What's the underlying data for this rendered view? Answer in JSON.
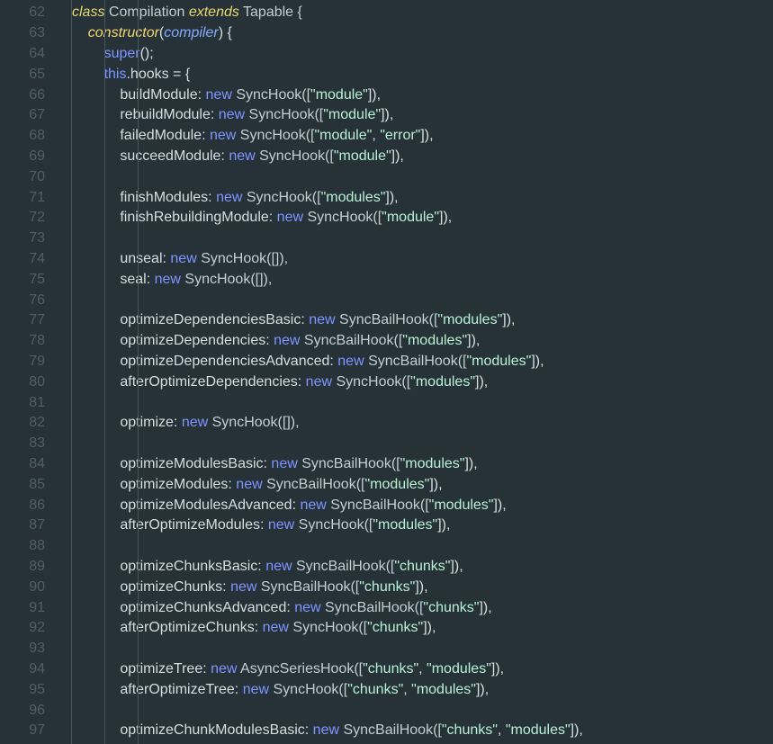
{
  "editor": {
    "lines": [
      {
        "number": "62",
        "parts": [
          {
            "text": "class",
            "kind": "class-kw"
          },
          {
            "text": " Compilation ",
            "kind": "type"
          },
          {
            "text": "extends",
            "kind": "extends-kw"
          },
          {
            "text": " Tapable {",
            "kind": "type"
          }
        ]
      },
      {
        "number": "63",
        "parts": [
          {
            "text": "    ",
            "kind": "punc"
          },
          {
            "text": "constructor",
            "kind": "fn"
          },
          {
            "text": "(",
            "kind": "punc"
          },
          {
            "text": "compiler",
            "kind": "param"
          },
          {
            "text": ") {",
            "kind": "punc"
          }
        ]
      },
      {
        "number": "64",
        "parts": [
          {
            "text": "        ",
            "kind": "punc"
          },
          {
            "text": "super",
            "kind": "kw"
          },
          {
            "text": "();",
            "kind": "punc"
          }
        ]
      },
      {
        "number": "65",
        "parts": [
          {
            "text": "        ",
            "kind": "punc"
          },
          {
            "text": "this",
            "kind": "kw"
          },
          {
            "text": ".hooks = {",
            "kind": "punc"
          }
        ]
      },
      {
        "number": "66",
        "parts": [
          {
            "text": "            ",
            "kind": "punc"
          },
          {
            "text": "buildModule",
            "kind": "property"
          },
          {
            "text": ": ",
            "kind": "punc"
          },
          {
            "text": "new",
            "kind": "kw"
          },
          {
            "text": " SyncHook([",
            "kind": "type"
          },
          {
            "text": "\"module\"",
            "kind": "string"
          },
          {
            "text": "]),",
            "kind": "punc"
          }
        ]
      },
      {
        "number": "67",
        "parts": [
          {
            "text": "            ",
            "kind": "punc"
          },
          {
            "text": "rebuildModule",
            "kind": "property"
          },
          {
            "text": ": ",
            "kind": "punc"
          },
          {
            "text": "new",
            "kind": "kw"
          },
          {
            "text": " SyncHook([",
            "kind": "type"
          },
          {
            "text": "\"module\"",
            "kind": "string"
          },
          {
            "text": "]),",
            "kind": "punc"
          }
        ]
      },
      {
        "number": "68",
        "parts": [
          {
            "text": "            ",
            "kind": "punc"
          },
          {
            "text": "failedModule",
            "kind": "property"
          },
          {
            "text": ": ",
            "kind": "punc"
          },
          {
            "text": "new",
            "kind": "kw"
          },
          {
            "text": " SyncHook([",
            "kind": "type"
          },
          {
            "text": "\"module\"",
            "kind": "string"
          },
          {
            "text": ", ",
            "kind": "punc"
          },
          {
            "text": "\"error\"",
            "kind": "string"
          },
          {
            "text": "]),",
            "kind": "punc"
          }
        ]
      },
      {
        "number": "69",
        "parts": [
          {
            "text": "            ",
            "kind": "punc"
          },
          {
            "text": "succeedModule",
            "kind": "property"
          },
          {
            "text": ": ",
            "kind": "punc"
          },
          {
            "text": "new",
            "kind": "kw"
          },
          {
            "text": " SyncHook([",
            "kind": "type"
          },
          {
            "text": "\"module\"",
            "kind": "string"
          },
          {
            "text": "]),",
            "kind": "punc"
          }
        ]
      },
      {
        "number": "70",
        "parts": []
      },
      {
        "number": "71",
        "parts": [
          {
            "text": "            ",
            "kind": "punc"
          },
          {
            "text": "finishModules",
            "kind": "property"
          },
          {
            "text": ": ",
            "kind": "punc"
          },
          {
            "text": "new",
            "kind": "kw"
          },
          {
            "text": " SyncHook([",
            "kind": "type"
          },
          {
            "text": "\"modules\"",
            "kind": "string"
          },
          {
            "text": "]),",
            "kind": "punc"
          }
        ]
      },
      {
        "number": "72",
        "parts": [
          {
            "text": "            ",
            "kind": "punc"
          },
          {
            "text": "finishRebuildingModule",
            "kind": "property"
          },
          {
            "text": ": ",
            "kind": "punc"
          },
          {
            "text": "new",
            "kind": "kw"
          },
          {
            "text": " SyncHook([",
            "kind": "type"
          },
          {
            "text": "\"module\"",
            "kind": "string"
          },
          {
            "text": "]),",
            "kind": "punc"
          }
        ]
      },
      {
        "number": "73",
        "parts": []
      },
      {
        "number": "74",
        "parts": [
          {
            "text": "            ",
            "kind": "punc"
          },
          {
            "text": "unseal",
            "kind": "property"
          },
          {
            "text": ": ",
            "kind": "punc"
          },
          {
            "text": "new",
            "kind": "kw"
          },
          {
            "text": " SyncHook([]),",
            "kind": "type"
          }
        ]
      },
      {
        "number": "75",
        "parts": [
          {
            "text": "            ",
            "kind": "punc"
          },
          {
            "text": "seal",
            "kind": "property"
          },
          {
            "text": ": ",
            "kind": "punc"
          },
          {
            "text": "new",
            "kind": "kw"
          },
          {
            "text": " SyncHook([]),",
            "kind": "type"
          }
        ]
      },
      {
        "number": "76",
        "parts": []
      },
      {
        "number": "77",
        "parts": [
          {
            "text": "            ",
            "kind": "punc"
          },
          {
            "text": "optimizeDependenciesBasic",
            "kind": "property"
          },
          {
            "text": ": ",
            "kind": "punc"
          },
          {
            "text": "new",
            "kind": "kw"
          },
          {
            "text": " SyncBailHook([",
            "kind": "type"
          },
          {
            "text": "\"modules\"",
            "kind": "string"
          },
          {
            "text": "]),",
            "kind": "punc"
          }
        ]
      },
      {
        "number": "78",
        "parts": [
          {
            "text": "            ",
            "kind": "punc"
          },
          {
            "text": "optimizeDependencies",
            "kind": "property"
          },
          {
            "text": ": ",
            "kind": "punc"
          },
          {
            "text": "new",
            "kind": "kw"
          },
          {
            "text": " SyncBailHook([",
            "kind": "type"
          },
          {
            "text": "\"modules\"",
            "kind": "string"
          },
          {
            "text": "]),",
            "kind": "punc"
          }
        ]
      },
      {
        "number": "79",
        "parts": [
          {
            "text": "            ",
            "kind": "punc"
          },
          {
            "text": "optimizeDependenciesAdvanced",
            "kind": "property"
          },
          {
            "text": ": ",
            "kind": "punc"
          },
          {
            "text": "new",
            "kind": "kw"
          },
          {
            "text": " SyncBailHook([",
            "kind": "type"
          },
          {
            "text": "\"modules\"",
            "kind": "string"
          },
          {
            "text": "]),",
            "kind": "punc"
          }
        ]
      },
      {
        "number": "80",
        "parts": [
          {
            "text": "            ",
            "kind": "punc"
          },
          {
            "text": "afterOptimizeDependencies",
            "kind": "property"
          },
          {
            "text": ": ",
            "kind": "punc"
          },
          {
            "text": "new",
            "kind": "kw"
          },
          {
            "text": " SyncHook([",
            "kind": "type"
          },
          {
            "text": "\"modules\"",
            "kind": "string"
          },
          {
            "text": "]),",
            "kind": "punc"
          }
        ]
      },
      {
        "number": "81",
        "parts": []
      },
      {
        "number": "82",
        "parts": [
          {
            "text": "            ",
            "kind": "punc"
          },
          {
            "text": "optimize",
            "kind": "property"
          },
          {
            "text": ": ",
            "kind": "punc"
          },
          {
            "text": "new",
            "kind": "kw"
          },
          {
            "text": " SyncHook([]),",
            "kind": "type"
          }
        ]
      },
      {
        "number": "83",
        "parts": []
      },
      {
        "number": "84",
        "parts": [
          {
            "text": "            ",
            "kind": "punc"
          },
          {
            "text": "optimizeModulesBasic",
            "kind": "property"
          },
          {
            "text": ": ",
            "kind": "punc"
          },
          {
            "text": "new",
            "kind": "kw"
          },
          {
            "text": " SyncBailHook([",
            "kind": "type"
          },
          {
            "text": "\"modules\"",
            "kind": "string"
          },
          {
            "text": "]),",
            "kind": "punc"
          }
        ]
      },
      {
        "number": "85",
        "parts": [
          {
            "text": "            ",
            "kind": "punc"
          },
          {
            "text": "optimizeModules",
            "kind": "property"
          },
          {
            "text": ": ",
            "kind": "punc"
          },
          {
            "text": "new",
            "kind": "kw"
          },
          {
            "text": " SyncBailHook([",
            "kind": "type"
          },
          {
            "text": "\"modules\"",
            "kind": "string"
          },
          {
            "text": "]),",
            "kind": "punc"
          }
        ]
      },
      {
        "number": "86",
        "parts": [
          {
            "text": "            ",
            "kind": "punc"
          },
          {
            "text": "optimizeModulesAdvanced",
            "kind": "property"
          },
          {
            "text": ": ",
            "kind": "punc"
          },
          {
            "text": "new",
            "kind": "kw"
          },
          {
            "text": " SyncBailHook([",
            "kind": "type"
          },
          {
            "text": "\"modules\"",
            "kind": "string"
          },
          {
            "text": "]),",
            "kind": "punc"
          }
        ]
      },
      {
        "number": "87",
        "parts": [
          {
            "text": "            ",
            "kind": "punc"
          },
          {
            "text": "afterOptimizeModules",
            "kind": "property"
          },
          {
            "text": ": ",
            "kind": "punc"
          },
          {
            "text": "new",
            "kind": "kw"
          },
          {
            "text": " SyncHook([",
            "kind": "type"
          },
          {
            "text": "\"modules\"",
            "kind": "string"
          },
          {
            "text": "]),",
            "kind": "punc"
          }
        ]
      },
      {
        "number": "88",
        "parts": []
      },
      {
        "number": "89",
        "parts": [
          {
            "text": "            ",
            "kind": "punc"
          },
          {
            "text": "optimizeChunksBasic",
            "kind": "property"
          },
          {
            "text": ": ",
            "kind": "punc"
          },
          {
            "text": "new",
            "kind": "kw"
          },
          {
            "text": " SyncBailHook([",
            "kind": "type"
          },
          {
            "text": "\"chunks\"",
            "kind": "string"
          },
          {
            "text": "]),",
            "kind": "punc"
          }
        ]
      },
      {
        "number": "90",
        "parts": [
          {
            "text": "            ",
            "kind": "punc"
          },
          {
            "text": "optimizeChunks",
            "kind": "property"
          },
          {
            "text": ": ",
            "kind": "punc"
          },
          {
            "text": "new",
            "kind": "kw"
          },
          {
            "text": " SyncBailHook([",
            "kind": "type"
          },
          {
            "text": "\"chunks\"",
            "kind": "string"
          },
          {
            "text": "]),",
            "kind": "punc"
          }
        ]
      },
      {
        "number": "91",
        "parts": [
          {
            "text": "            ",
            "kind": "punc"
          },
          {
            "text": "optimizeChunksAdvanced",
            "kind": "property"
          },
          {
            "text": ": ",
            "kind": "punc"
          },
          {
            "text": "new",
            "kind": "kw"
          },
          {
            "text": " SyncBailHook([",
            "kind": "type"
          },
          {
            "text": "\"chunks\"",
            "kind": "string"
          },
          {
            "text": "]),",
            "kind": "punc"
          }
        ]
      },
      {
        "number": "92",
        "parts": [
          {
            "text": "            ",
            "kind": "punc"
          },
          {
            "text": "afterOptimizeChunks",
            "kind": "property"
          },
          {
            "text": ": ",
            "kind": "punc"
          },
          {
            "text": "new",
            "kind": "kw"
          },
          {
            "text": " SyncHook([",
            "kind": "type"
          },
          {
            "text": "\"chunks\"",
            "kind": "string"
          },
          {
            "text": "]),",
            "kind": "punc"
          }
        ]
      },
      {
        "number": "93",
        "parts": []
      },
      {
        "number": "94",
        "parts": [
          {
            "text": "            ",
            "kind": "punc"
          },
          {
            "text": "optimizeTree",
            "kind": "property"
          },
          {
            "text": ": ",
            "kind": "punc"
          },
          {
            "text": "new",
            "kind": "kw"
          },
          {
            "text": " AsyncSeriesHook([",
            "kind": "type"
          },
          {
            "text": "\"chunks\"",
            "kind": "string"
          },
          {
            "text": ", ",
            "kind": "punc"
          },
          {
            "text": "\"modules\"",
            "kind": "string"
          },
          {
            "text": "]),",
            "kind": "punc"
          }
        ]
      },
      {
        "number": "95",
        "parts": [
          {
            "text": "            ",
            "kind": "punc"
          },
          {
            "text": "afterOptimizeTree",
            "kind": "property"
          },
          {
            "text": ": ",
            "kind": "punc"
          },
          {
            "text": "new",
            "kind": "kw"
          },
          {
            "text": " SyncHook([",
            "kind": "type"
          },
          {
            "text": "\"chunks\"",
            "kind": "string"
          },
          {
            "text": ", ",
            "kind": "punc"
          },
          {
            "text": "\"modules\"",
            "kind": "string"
          },
          {
            "text": "]),",
            "kind": "punc"
          }
        ]
      },
      {
        "number": "96",
        "parts": []
      },
      {
        "number": "97",
        "parts": [
          {
            "text": "            ",
            "kind": "punc"
          },
          {
            "text": "optimizeChunkModulesBasic",
            "kind": "property"
          },
          {
            "text": ": ",
            "kind": "punc"
          },
          {
            "text": "new",
            "kind": "kw"
          },
          {
            "text": " SyncBailHook([",
            "kind": "type"
          },
          {
            "text": "\"chunks\"",
            "kind": "string"
          },
          {
            "text": ", ",
            "kind": "punc"
          },
          {
            "text": "\"modules\"",
            "kind": "string"
          },
          {
            "text": "]),",
            "kind": "punc"
          }
        ]
      }
    ]
  },
  "colors": {
    "background": "#263238",
    "line_number": "#4f5f66",
    "indent_guide": "#46555b",
    "keyword": "#7f95ff",
    "function": "#f5d76e",
    "parameter": "#82aaff",
    "string": "#b8f2d4",
    "text": "#c3ced3"
  }
}
